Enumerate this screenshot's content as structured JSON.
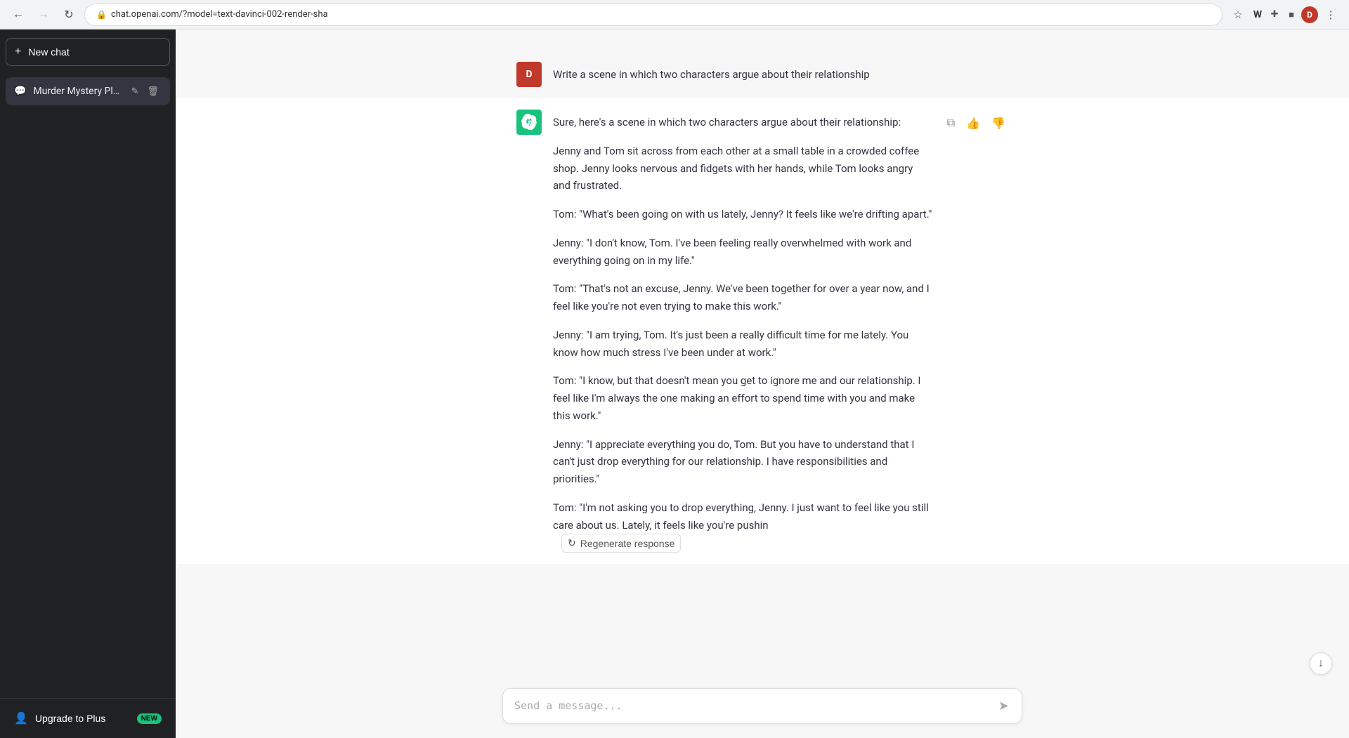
{
  "browser": {
    "url": "chat.openai.com/?model=text-davinci-002-render-sha",
    "back_disabled": false,
    "forward_disabled": true
  },
  "sidebar": {
    "new_chat_label": "New chat",
    "chats": [
      {
        "title": "Murder Mystery Plot..",
        "active": true
      }
    ],
    "upgrade_label": "Upgrade to Plus",
    "new_badge": "NEW"
  },
  "messages": [
    {
      "role": "user",
      "avatar_letter": "D",
      "text": "Write a scene in which two characters argue about their relationship"
    },
    {
      "role": "assistant",
      "paragraphs": [
        "Sure, here's a scene in which two characters argue about their relationship:",
        "Jenny and Tom sit across from each other at a small table in a crowded coffee shop. Jenny looks nervous and fidgets with her hands, while Tom looks angry and frustrated.",
        "Tom: \"What's been going on with us lately, Jenny? It feels like we're drifting apart.\"",
        "Jenny: \"I don't know, Tom. I've been feeling really overwhelmed with work and everything going on in my life.\"",
        "Tom: \"That's not an excuse, Jenny. We've been together for over a year now, and I feel like you're not even trying to make this work.\"",
        "Jenny: \"I am trying, Tom. It's just been a really difficult time for me lately. You know how much stress I've been under at work.\"",
        "Tom: \"I know, but that doesn't mean you get to ignore me and our relationship. I feel like I'm always the one making an effort to spend time with you and make this work.\"",
        "Jenny: \"I appreciate everything you do, Tom. But you have to understand that I can't just drop everything for our relationship. I have responsibilities and priorities.\"",
        "Tom: \"I'm not asking you to drop everything, Jenny. I just want to feel like you still care about us. Lately, it feels like you're pushin"
      ]
    }
  ],
  "regen_label": "Regenerate response",
  "input": {
    "placeholder": "Send a message..."
  },
  "icons": {
    "copy": "⧉",
    "thumbs_up": "👍",
    "thumbs_down": "👎",
    "regen": "↺",
    "scroll_down": "↓",
    "send": "➤",
    "chat_bubble": "💬",
    "pencil": "✏",
    "trash": "🗑",
    "person": "👤",
    "plus": "+",
    "back": "←",
    "forward": "→",
    "refresh": "↻",
    "star": "☆",
    "ext": "⊞",
    "more": "⋮"
  }
}
